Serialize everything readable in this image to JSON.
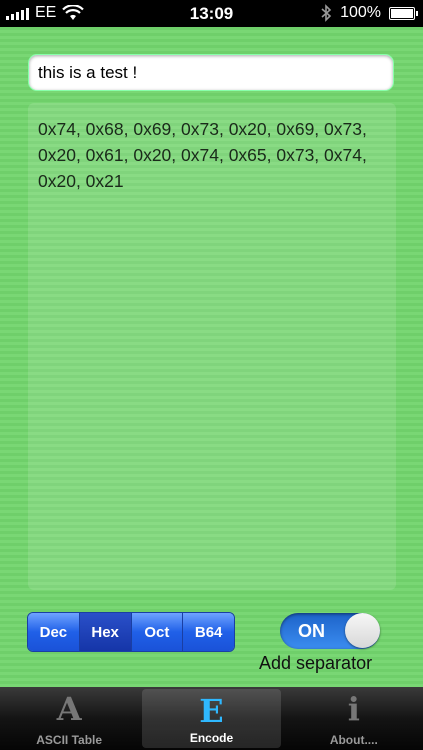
{
  "status_bar": {
    "carrier": "EE",
    "time": "13:09",
    "battery_percent": "100%",
    "battery_level": 1.0,
    "icons": [
      "signal-icon",
      "wifi-icon",
      "bluetooth-icon",
      "battery-icon"
    ]
  },
  "input": {
    "value": "this is a test !"
  },
  "output": {
    "text": "0x74, 0x68, 0x69, 0x73, 0x20, 0x69, 0x73, 0x20, 0x61, 0x20, 0x74, 0x65, 0x73, 0x74, 0x20, 0x21"
  },
  "format_selector": {
    "options": [
      "Dec",
      "Hex",
      "Oct",
      "B64"
    ],
    "selected": "Hex"
  },
  "separator_toggle": {
    "state_label": "ON",
    "caption": "Add separator"
  },
  "tab_bar": {
    "tabs": [
      {
        "label": "ASCII Table",
        "icon_glyph": "A",
        "icon": "ascii-table-icon"
      },
      {
        "label": "Encode",
        "icon_glyph": "E",
        "icon": "encode-icon"
      },
      {
        "label": "About....",
        "icon_glyph": "i",
        "icon": "about-icon"
      }
    ],
    "active": "Encode"
  },
  "colors": {
    "background_green": "#6fcf6a",
    "segment_blue": "#2060e8",
    "toggle_blue": "#2f7be0",
    "active_tab_icon": "#2fb8ff"
  }
}
